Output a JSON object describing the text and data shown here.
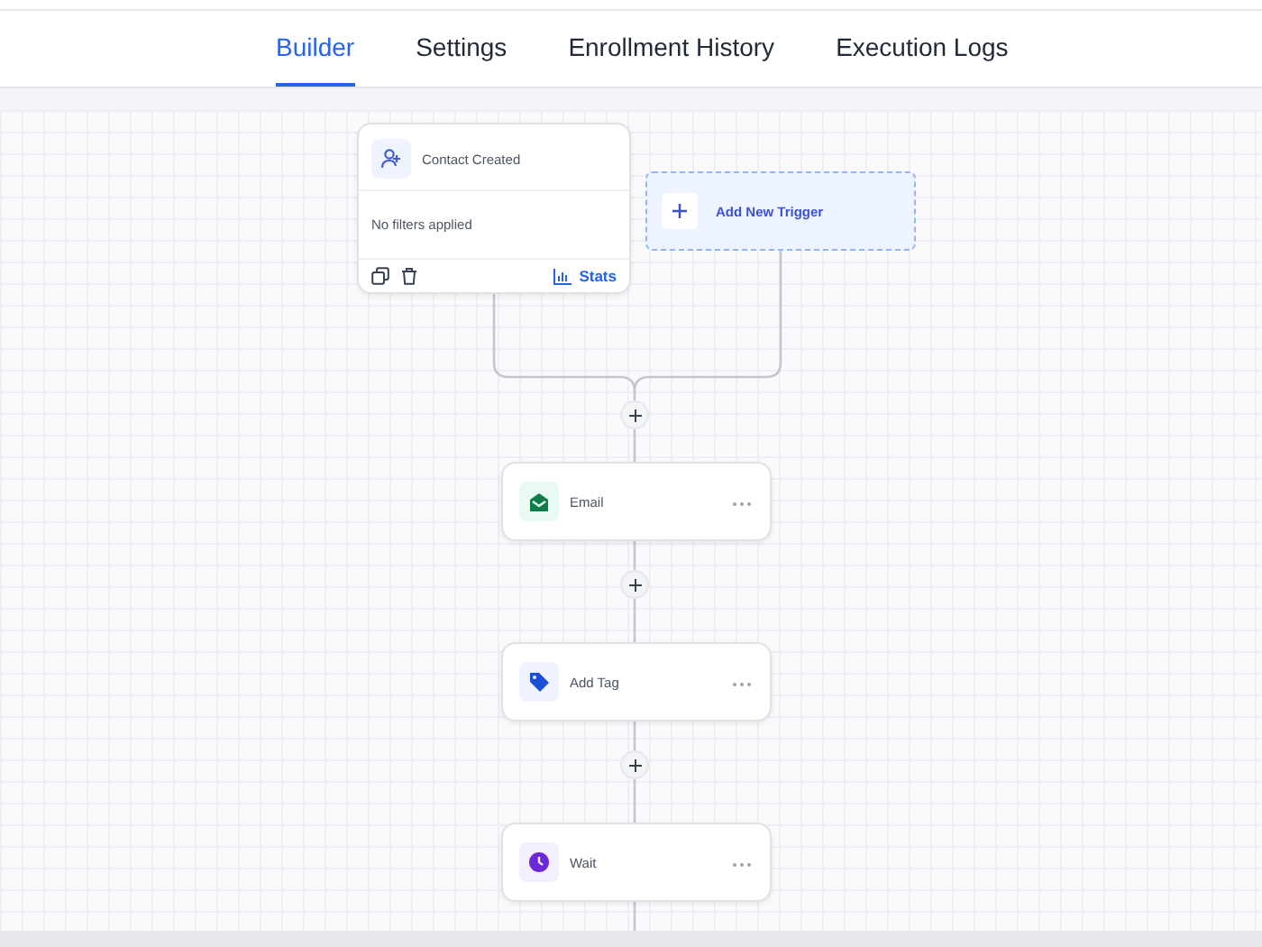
{
  "tabs": [
    {
      "label": "Builder",
      "selected": true
    },
    {
      "label": "Settings",
      "selected": false
    },
    {
      "label": "Enrollment History",
      "selected": false
    },
    {
      "label": "Execution Logs",
      "selected": false
    }
  ],
  "trigger": {
    "title": "Contact Created",
    "filter_text": "No filters applied",
    "stats_label": "Stats"
  },
  "add_trigger": {
    "label": "Add New Trigger"
  },
  "steps": [
    {
      "label": "Email",
      "kind": "email"
    },
    {
      "label": "Add Tag",
      "kind": "tag"
    },
    {
      "label": "Wait",
      "kind": "wait"
    }
  ]
}
